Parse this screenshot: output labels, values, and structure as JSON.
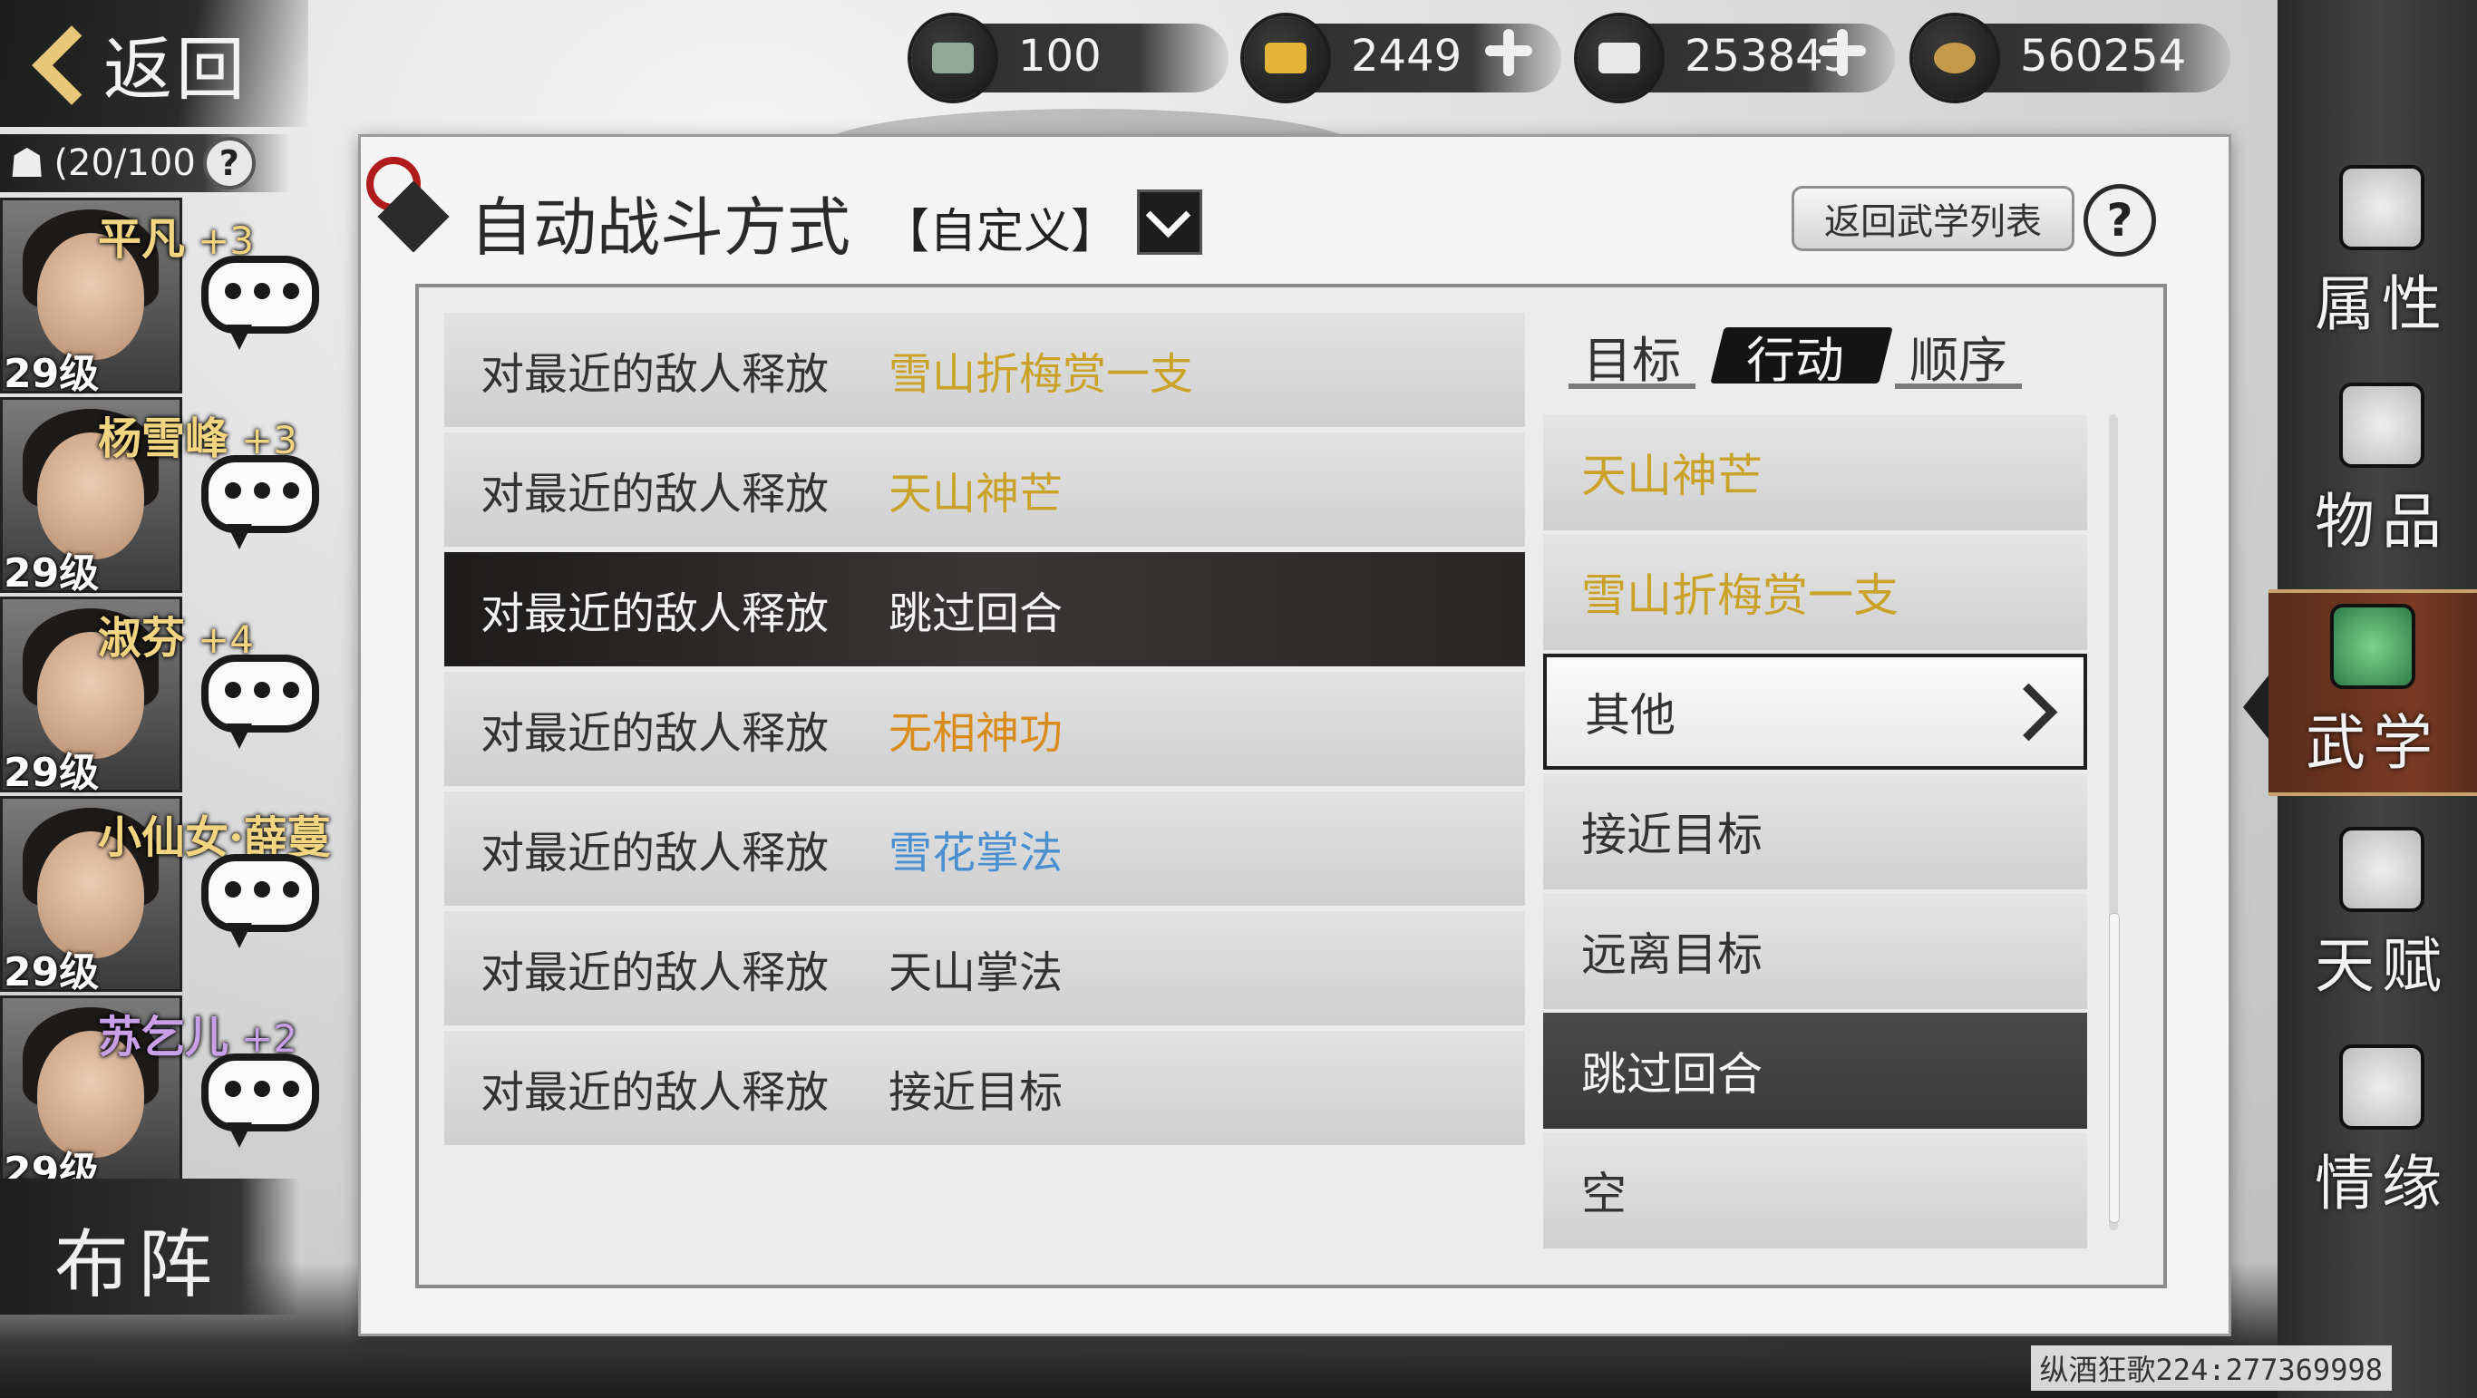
{
  "back": {
    "label": "返回"
  },
  "currency": [
    {
      "icon": "bronze-cauldron-icon",
      "value": "100",
      "plus": false
    },
    {
      "icon": "gold-ingot-icon",
      "value": "2449",
      "plus": true
    },
    {
      "icon": "silver-ingot-icon",
      "value": "253843",
      "plus": true
    },
    {
      "icon": "copper-coin-icon",
      "value": "560254",
      "plus": false
    }
  ],
  "roster": {
    "count": "(20/100",
    "help": "?",
    "heroes": [
      {
        "name": "平凡",
        "bonus": "+3",
        "level": "29级",
        "name_color": "#f2d580"
      },
      {
        "name": "杨雪峰",
        "bonus": "+3",
        "level": "29级",
        "name_color": "#f2d580"
      },
      {
        "name": "淑芬",
        "bonus": "+4",
        "level": "29级",
        "name_color": "#f2d580"
      },
      {
        "name": "小仙女·薛蔓",
        "bonus": "",
        "level": "29级",
        "name_color": "#f2d580"
      },
      {
        "name": "苏乞儿",
        "bonus": "+2",
        "level": "29级",
        "name_color": "#c8a0e8"
      }
    ],
    "formation": "布阵"
  },
  "panel": {
    "title": "自动战斗方式",
    "mode": "【自定义】",
    "return_label": "返回武学列表",
    "help": "?"
  },
  "rules": [
    {
      "condition": "对最近的敌人释放",
      "action": "雪山折梅赏一支",
      "color": "#c9a227",
      "selected": false
    },
    {
      "condition": "对最近的敌人释放",
      "action": "天山神芒",
      "color": "#c9a227",
      "selected": false
    },
    {
      "condition": "对最近的敌人释放",
      "action": "跳过回合",
      "color": "#f4f4f4",
      "selected": true
    },
    {
      "condition": "对最近的敌人释放",
      "action": "无相神功",
      "color": "#d98c1c",
      "selected": false
    },
    {
      "condition": "对最近的敌人释放",
      "action": "雪花掌法",
      "color": "#4a8fd0",
      "selected": false
    },
    {
      "condition": "对最近的敌人释放",
      "action": "天山掌法",
      "color": "#333333",
      "selected": false
    },
    {
      "condition": "对最近的敌人释放",
      "action": "接近目标",
      "color": "#333333",
      "selected": false
    }
  ],
  "tabs": [
    {
      "label": "目标",
      "active": false
    },
    {
      "label": "行动",
      "active": true
    },
    {
      "label": "顺序",
      "active": false
    }
  ],
  "actions": [
    {
      "label": "天山神芒",
      "color": "#c9a227",
      "style": "normal"
    },
    {
      "label": "雪山折梅赏一支",
      "color": "#c9a227",
      "style": "normal"
    },
    {
      "label": "其他",
      "color": "#333333",
      "style": "framed"
    },
    {
      "label": "接近目标",
      "color": "#333333",
      "style": "normal"
    },
    {
      "label": "远离目标",
      "color": "#333333",
      "style": "normal"
    },
    {
      "label": "跳过回合",
      "color": "#f6f6f6",
      "style": "dark"
    },
    {
      "label": "空",
      "color": "#333333",
      "style": "normal"
    }
  ],
  "nav": [
    {
      "label": "属性",
      "icon": "fan-icon",
      "active": false
    },
    {
      "label": "物品",
      "icon": "gift-box-icon",
      "active": false
    },
    {
      "label": "武学",
      "icon": "book-stack-icon",
      "active": true
    },
    {
      "label": "天赋",
      "icon": "talent-tree-icon",
      "active": false
    },
    {
      "label": "情缘",
      "icon": "heart-knot-icon",
      "active": false
    }
  ],
  "watermark": "纵酒狂歌224:277369998"
}
